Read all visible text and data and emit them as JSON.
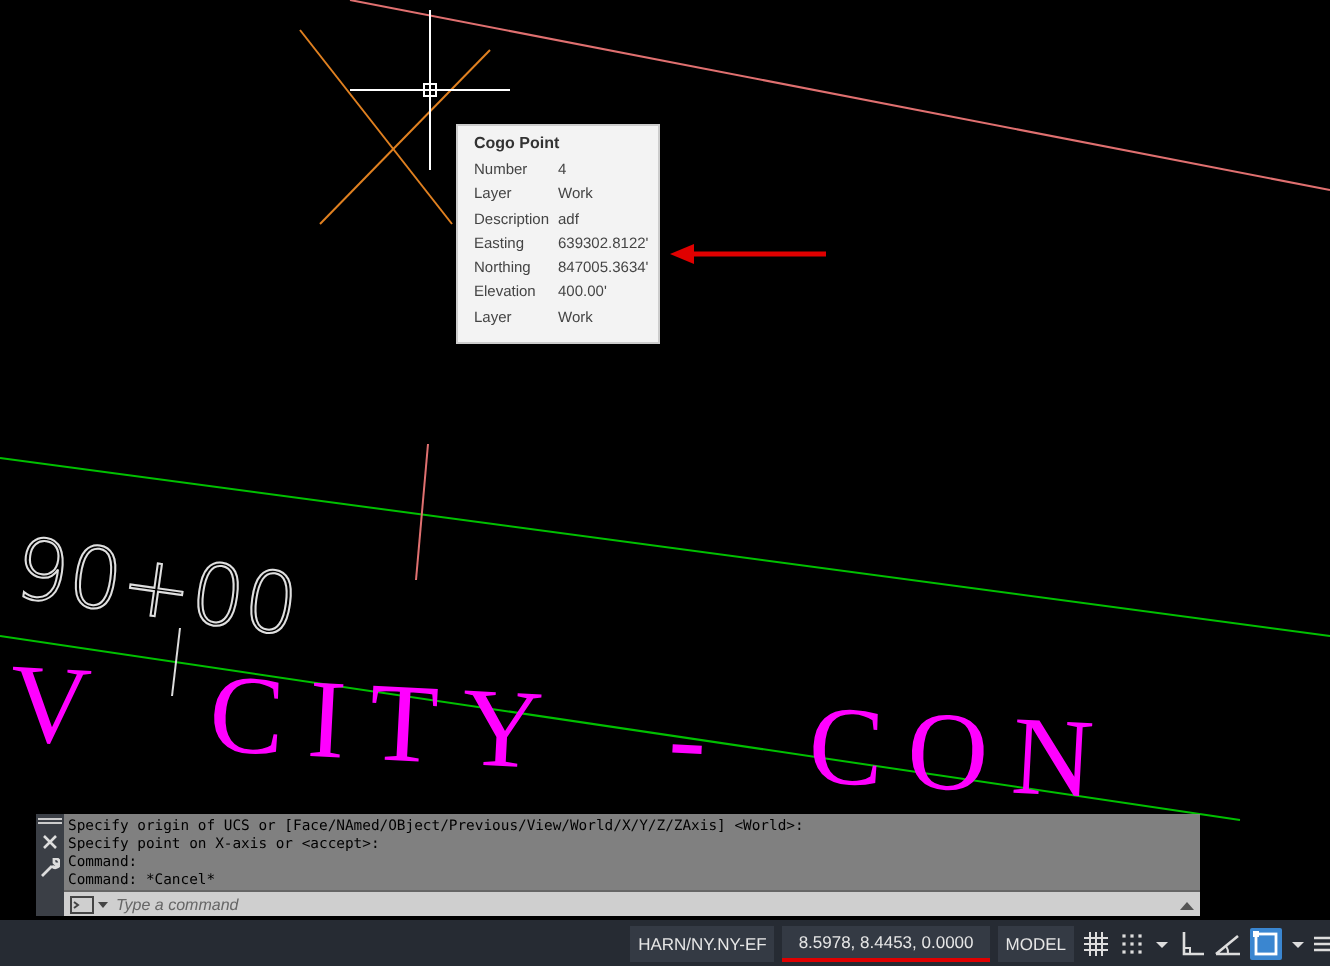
{
  "drawing": {
    "station_label": "90+00",
    "title_words": [
      "V",
      "CITY",
      "-",
      "CON"
    ]
  },
  "tooltip": {
    "title": "Cogo Point",
    "rows": [
      {
        "label": "Number",
        "value": "4"
      },
      {
        "label": "Layer",
        "value": "Work"
      },
      {
        "label": "Description",
        "value": "adf"
      },
      {
        "label": "Easting",
        "value": "639302.8122'"
      },
      {
        "label": "Northing",
        "value": "847005.3634'"
      },
      {
        "label": "Elevation",
        "value": "400.00'"
      },
      {
        "label": "Layer",
        "value": "Work"
      }
    ]
  },
  "command_window": {
    "history": [
      "Specify origin of UCS or [Face/NAmed/OBject/Previous/View/World/X/Y/Z/ZAxis] <World>:",
      "Specify point on X-axis or <accept>:",
      "Command:",
      "Command: *Cancel*"
    ],
    "placeholder": "Type a command"
  },
  "status_bar": {
    "coordinate_system": "HARN/NY.NY-EF",
    "coordinates": "8.5978, 8.4453, 0.0000",
    "space": "MODEL",
    "toggles": [
      {
        "kind": "grid",
        "on": false
      },
      {
        "kind": "snap",
        "on": false
      },
      {
        "kind": "caret",
        "on": false
      },
      {
        "kind": "ortho",
        "on": false
      },
      {
        "kind": "polar",
        "on": false
      },
      {
        "kind": "select",
        "on": true
      },
      {
        "kind": "caret",
        "on": false
      },
      {
        "kind": "menu",
        "on": false
      }
    ]
  }
}
